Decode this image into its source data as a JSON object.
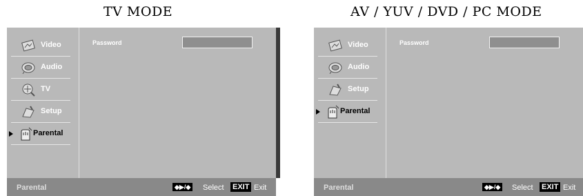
{
  "titles": {
    "left": "TV MODE",
    "right": "AV / YUV / DVD / PC  MODE"
  },
  "menu": {
    "video": "Video",
    "audio": "Audio",
    "tv": "TV",
    "setup": "Setup",
    "parental": "Parental"
  },
  "content": {
    "password_label": "Password"
  },
  "footer": {
    "current": "Parental",
    "nav_keys": "◆▶/◆",
    "select": "Select",
    "exit_key": "EXIT",
    "exit": "Exit"
  },
  "icons": [
    "video-icon",
    "audio-icon",
    "tv-icon",
    "setup-icon",
    "parental-icon"
  ]
}
